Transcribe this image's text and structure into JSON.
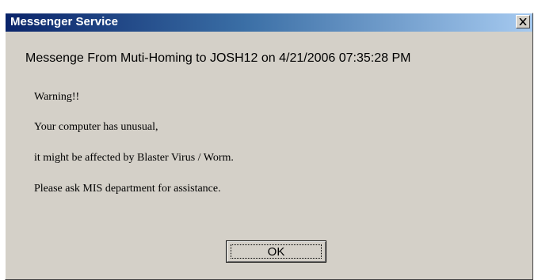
{
  "window": {
    "title": "Messenger Service",
    "close_glyph": "X"
  },
  "message": {
    "header": "Messenge From Muti-Homing to JOSH12 on 4/21/2006 07:35:28 PM",
    "lines": [
      "Warning!!",
      "Your computer has unusual,",
      "it might be affected by Blaster Virus / Worm.",
      "Please ask MIS department for assistance."
    ]
  },
  "buttons": {
    "ok_label": "OK"
  },
  "colors": {
    "titlebar_start": "#0a246a",
    "titlebar_end": "#a6caf0",
    "face": "#d4d0c8"
  },
  "icons": {
    "close": "close-icon"
  }
}
